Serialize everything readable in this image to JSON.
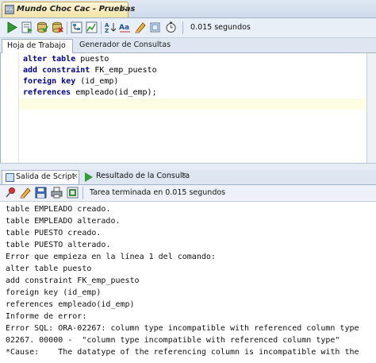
{
  "window": {
    "doc_tab_title": "Mundo Choc Cac - Pruebas",
    "sql_icon_text": "SQL",
    "close_glyph": "×"
  },
  "toolbar": {
    "icons": [
      "run-statement-icon",
      "run-script-icon",
      "commit-icon",
      "rollback-icon",
      "explain-plan-icon",
      "autotrace-icon",
      "clear-icon",
      "format-icon",
      "history-icon",
      "sql-tuning-icon"
    ],
    "timing": "0.015 segundos"
  },
  "editor_tabs": {
    "worksheet": "Hoja de Trabajo",
    "query_builder": "Generador de Consultas"
  },
  "editor": {
    "lines": [
      {
        "kw": "alter table",
        "rest": " puesto"
      },
      {
        "kw": "add constraint",
        "rest": " FK_emp_puesto"
      },
      {
        "kw": "foreign key",
        "rest": " (id_emp)"
      },
      {
        "kw": "references",
        "rest": " empleado(id_emp);"
      }
    ]
  },
  "output_tabs": {
    "script_output": "Salida de Script",
    "query_result": "Resultado de la Consulta",
    "close_glyph": "×"
  },
  "output_toolbar": {
    "icons": [
      "pin-icon",
      "eraser-icon",
      "save-icon",
      "print-icon",
      "save-as-icon"
    ],
    "status": "Tarea terminada en 0.015 segundos"
  },
  "output": {
    "lines": [
      "table EMPLEADO creado.",
      "table EMPLEADO alterado.",
      "table PUESTO creado.",
      "table PUESTO alterado.",
      "Error que empieza en la línea 1 del comando:",
      "alter table puesto",
      "add constraint FK_emp_puesto",
      "foreign key (id_emp)",
      "references empleado(id_emp)",
      "Informe de error:",
      "Error SQL: ORA-02267: column type incompatible with referenced column type",
      "02267. 00000 -  \"column type incompatible with referenced column type\"",
      "*Cause:    The datatype of the referencing column is incompatible with the"
    ]
  },
  "colors": {
    "keyword": "#00009a",
    "run_green": "#2f9d2f",
    "tab_active": "#f2e3a6"
  }
}
